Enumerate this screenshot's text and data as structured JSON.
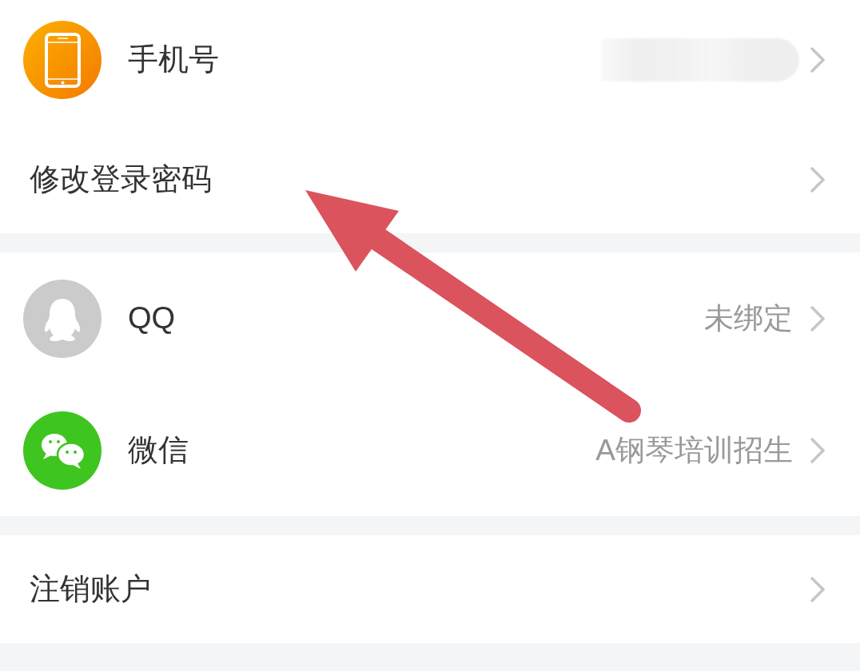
{
  "sections": [
    {
      "rows": [
        {
          "kind": "mobile",
          "label": "手机号",
          "value_blurred": true
        },
        {
          "kind": "plain",
          "label": "修改登录密码"
        }
      ]
    },
    {
      "rows": [
        {
          "kind": "qq",
          "label": "QQ",
          "value": "未绑定"
        },
        {
          "kind": "wechat",
          "label": "微信",
          "value": "A钢琴培训招生"
        }
      ]
    },
    {
      "rows": [
        {
          "kind": "plain",
          "label": "注销账户"
        }
      ]
    }
  ]
}
